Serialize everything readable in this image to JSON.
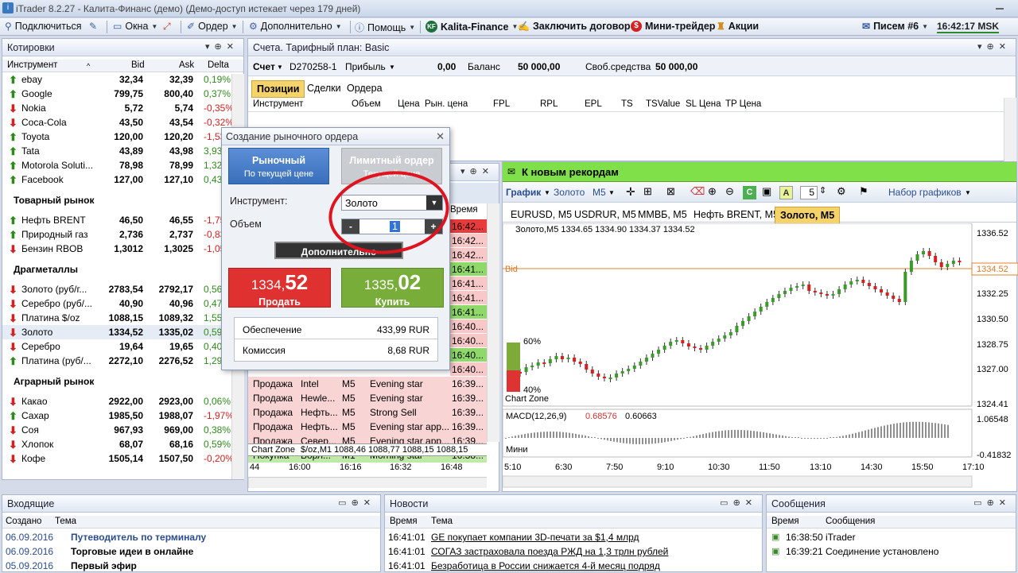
{
  "window": {
    "title": "iTrader 8.2.27 - Калита-Финанс (демо) (Демо-доступ истекает через 179 дней)"
  },
  "menu": {
    "connect": "Подключиться",
    "windows": "Окна",
    "order": "Ордер",
    "more": "Дополнительно",
    "help": "Помощь",
    "kalita": "Kalita-Finance",
    "contract": "Заключить договор",
    "minitrader": "Мини-трейдер",
    "stocks": "Акции",
    "mail": "Писем #6",
    "time": "16:42:17 MSK"
  },
  "quotes": {
    "title": "Котировки",
    "cols": {
      "instrument": "Инструмент",
      "bid": "Bid",
      "ask": "Ask",
      "delta": "Delta"
    },
    "rows": [
      {
        "name": "ebay",
        "bid": "32,34",
        "ask": "32,39",
        "delta": "0,19%",
        "dir": "up"
      },
      {
        "name": "Google",
        "bid": "799,75",
        "ask": "800,40",
        "delta": "0,37%",
        "dir": "up"
      },
      {
        "name": "Nokia",
        "bid": "5,72",
        "ask": "5,74",
        "delta": "-0,35%",
        "dir": "dn"
      },
      {
        "name": "Coca-Cola",
        "bid": "43,50",
        "ask": "43,54",
        "delta": "-0,32%",
        "dir": "dn"
      },
      {
        "name": "Toyota",
        "bid": "120,00",
        "ask": "120,20",
        "delta": "-1,53",
        "dir": "up"
      },
      {
        "name": "Tata",
        "bid": "43,89",
        "ask": "43,98",
        "delta": "3,93",
        "dir": "up"
      },
      {
        "name": "Motorola Soluti...",
        "bid": "78,98",
        "ask": "78,99",
        "delta": "1,32",
        "dir": "up"
      },
      {
        "name": "Facebook",
        "bid": "127,00",
        "ask": "127,10",
        "delta": "0,43",
        "dir": "up"
      }
    ],
    "sect1": "Товарный рынок",
    "rows2": [
      {
        "name": "Нефть BRENT",
        "bid": "46,50",
        "ask": "46,55",
        "delta": "-1,75",
        "dir": "up"
      },
      {
        "name": "Природный газ",
        "bid": "2,736",
        "ask": "2,737",
        "delta": "-0,83",
        "dir": "up"
      },
      {
        "name": "Бензин RBOB",
        "bid": "1,3012",
        "ask": "1,3025",
        "delta": "-1,05",
        "dir": "dn"
      }
    ],
    "sect2": "Драгметаллы",
    "rows3": [
      {
        "name": "Золото (руб/г...",
        "bid": "2783,54",
        "ask": "2792,17",
        "delta": "0,56%",
        "dir": "dn"
      },
      {
        "name": "Серебро (руб/...",
        "bid": "40,90",
        "ask": "40,96",
        "delta": "0,47",
        "dir": "dn"
      },
      {
        "name": "Платина $/oz",
        "bid": "1088,15",
        "ask": "1089,32",
        "delta": "1,55",
        "dir": "dn"
      },
      {
        "name": "Золото",
        "bid": "1334,52",
        "ask": "1335,02",
        "delta": "0,59",
        "dir": "dn"
      },
      {
        "name": "Серебро",
        "bid": "19,64",
        "ask": "19,65",
        "delta": "0,40",
        "dir": "dn"
      },
      {
        "name": "Платина (руб/...",
        "bid": "2272,10",
        "ask": "2276,52",
        "delta": "1,29",
        "dir": "up"
      }
    ],
    "sect3": "Аграрный рынок",
    "rows4": [
      {
        "name": "Какао",
        "bid": "2922,00",
        "ask": "2923,00",
        "delta": "0,06%",
        "dir": "dn"
      },
      {
        "name": "Сахар",
        "bid": "1985,50",
        "ask": "1988,07",
        "delta": "-1,97%",
        "dir": "up"
      },
      {
        "name": "Соя",
        "bid": "967,93",
        "ask": "969,00",
        "delta": "0,38%",
        "dir": "dn"
      },
      {
        "name": "Хлопок",
        "bid": "68,07",
        "ask": "68,16",
        "delta": "0,59%",
        "dir": "dn"
      },
      {
        "name": "Кофе",
        "bid": "1505,14",
        "ask": "1507,50",
        "delta": "-0,20%",
        "dir": "dn"
      }
    ]
  },
  "account": {
    "title": "Счета. Тарифный план: Basic",
    "label": "Счет",
    "id": "D270258-1",
    "profit": "Прибыль",
    "profit_val": "0,00",
    "balance": "Баланс",
    "balance_val": "50 000,00",
    "free": "Своб.средства",
    "free_val": "50 000,00",
    "tabs": [
      "Позиции",
      "Сделки",
      "Ордера"
    ],
    "cols": [
      "Инструмент",
      "Объем",
      "Цена",
      "Рын. цена",
      "FPL",
      "RPL",
      "EPL",
      "TS",
      "TSValue",
      "SL Цена",
      "TP Цена"
    ]
  },
  "signals": {
    "col_time": "Время",
    "times_top": [
      "16:42...",
      "16:42...",
      "16:42...",
      "16:41...",
      "16:41...",
      "16:41...",
      "16:41...",
      "16:40...",
      "16:40...",
      "16:40...",
      "16:40..."
    ],
    "rows": [
      {
        "a": "Продажа",
        "b": "Intel",
        "c": "M5",
        "d": "Evening star",
        "t": "16:39..."
      },
      {
        "a": "Продажа",
        "b": "Hewle...",
        "c": "M5",
        "d": "Evening star",
        "t": "16:39..."
      },
      {
        "a": "Продажа",
        "b": "Нефть...",
        "c": "M5",
        "d": "Strong Sell",
        "t": "16:39..."
      },
      {
        "a": "Продажа",
        "b": "Нефть...",
        "c": "M5",
        "d": "Evening star app...",
        "t": "16:39..."
      },
      {
        "a": "Продажа",
        "b": "Север...",
        "c": "M5",
        "d": "Evening star app...",
        "t": "16:39..."
      },
      {
        "a": "Покупка",
        "b": "Ворл...",
        "c": "M1",
        "d": "Morning star",
        "t": "16:38..."
      }
    ],
    "mini": "$/oz,M1  1088,46  1088,77  1088,15  1088,15",
    "mini_label": "Chart Zone",
    "xaxis": [
      "44",
      "16:00",
      "16:16",
      "16:32",
      "16:48"
    ]
  },
  "dialog": {
    "title": "Создание рыночного ордера",
    "market": "Рыночный",
    "market_sub": "По текущей цене",
    "limit": "Лимитный ордер",
    "limit_sub": "Текущей цене",
    "instr_label": "Инструмент:",
    "instr": "Золото",
    "vol_label": "Объем",
    "vol": "1",
    "minus": "-",
    "plus": "+",
    "more": "Дополнительно",
    "sell_int": "1334,",
    "sell_frac": "52",
    "sell": "Продать",
    "buy_int": "1335,",
    "buy_frac": "02",
    "buy": "Купить",
    "cover": "Обеспечение",
    "cover_val": "433,99 RUR",
    "fee": "Комиссия",
    "fee_val": "8,68 RUR"
  },
  "chart": {
    "banner": "К новым рекордам",
    "toolbar": {
      "chart": "График",
      "instr": "Золото",
      "tf": "M5",
      "num": "5",
      "sets": "Набор графиков"
    },
    "tabs": [
      "EURUSD, M5",
      "USDRUR, M5",
      "ММВБ, M5",
      "Нефть BRENT, M5",
      "Золото, M5"
    ],
    "info": "Золото,M5  1334.65  1334.90  1334.37  1334.52",
    "bid": "Bid",
    "bidval": "1334.52",
    "zone": "Chart Zone",
    "pct_top": "60%",
    "pct_bot": "40%",
    "macd": "MACD(12,26,9)",
    "macd1": "0.68576",
    "macd2": "0.60663",
    "macd_top": "1.06548",
    "macd_bot": "-0.41832",
    "macd_mini": "Мини",
    "yaxis": [
      "1336.52",
      "1334.52",
      "1332.25",
      "1330.50",
      "1328.75",
      "1327.00",
      "1324.41"
    ],
    "xaxis": [
      "5:10",
      "6:30",
      "7:50",
      "9:10",
      "10:30",
      "11:50",
      "13:10",
      "14:30",
      "15:50",
      "17:10"
    ]
  },
  "inbox": {
    "title": "Входящие",
    "cols": [
      "Создано",
      "Тема"
    ],
    "rows": [
      {
        "d": "06.09.2016",
        "t": "Путеводитель по терминалу"
      },
      {
        "d": "06.09.2016",
        "t": "Торговые идеи в онлайне"
      },
      {
        "d": "05.09.2016",
        "t": "Первый эфир"
      }
    ]
  },
  "news": {
    "title": "Новости",
    "cols": [
      "Время",
      "Тема"
    ],
    "rows": [
      {
        "d": "16:41:01",
        "t": "GE покупает компании 3D-печати за $1,4 млрд"
      },
      {
        "d": "16:41:01",
        "t": "СОГАЗ застраховала поезда РЖД на 1,3 трлн рублей"
      },
      {
        "d": "16:41:01",
        "t": "Безработица в России снижается 4-й месяц подряд"
      }
    ]
  },
  "messages": {
    "title": "Сообщения",
    "cols": [
      "Время",
      "Сообщения"
    ],
    "rows": [
      {
        "d": "16:38:50",
        "t": "iTrader"
      },
      {
        "d": "16:39:21",
        "t": "Соединение установлено"
      }
    ]
  },
  "colors": {
    "green": "#2f8a1d",
    "red": "#d32020",
    "accent": "#3a6fbb"
  }
}
